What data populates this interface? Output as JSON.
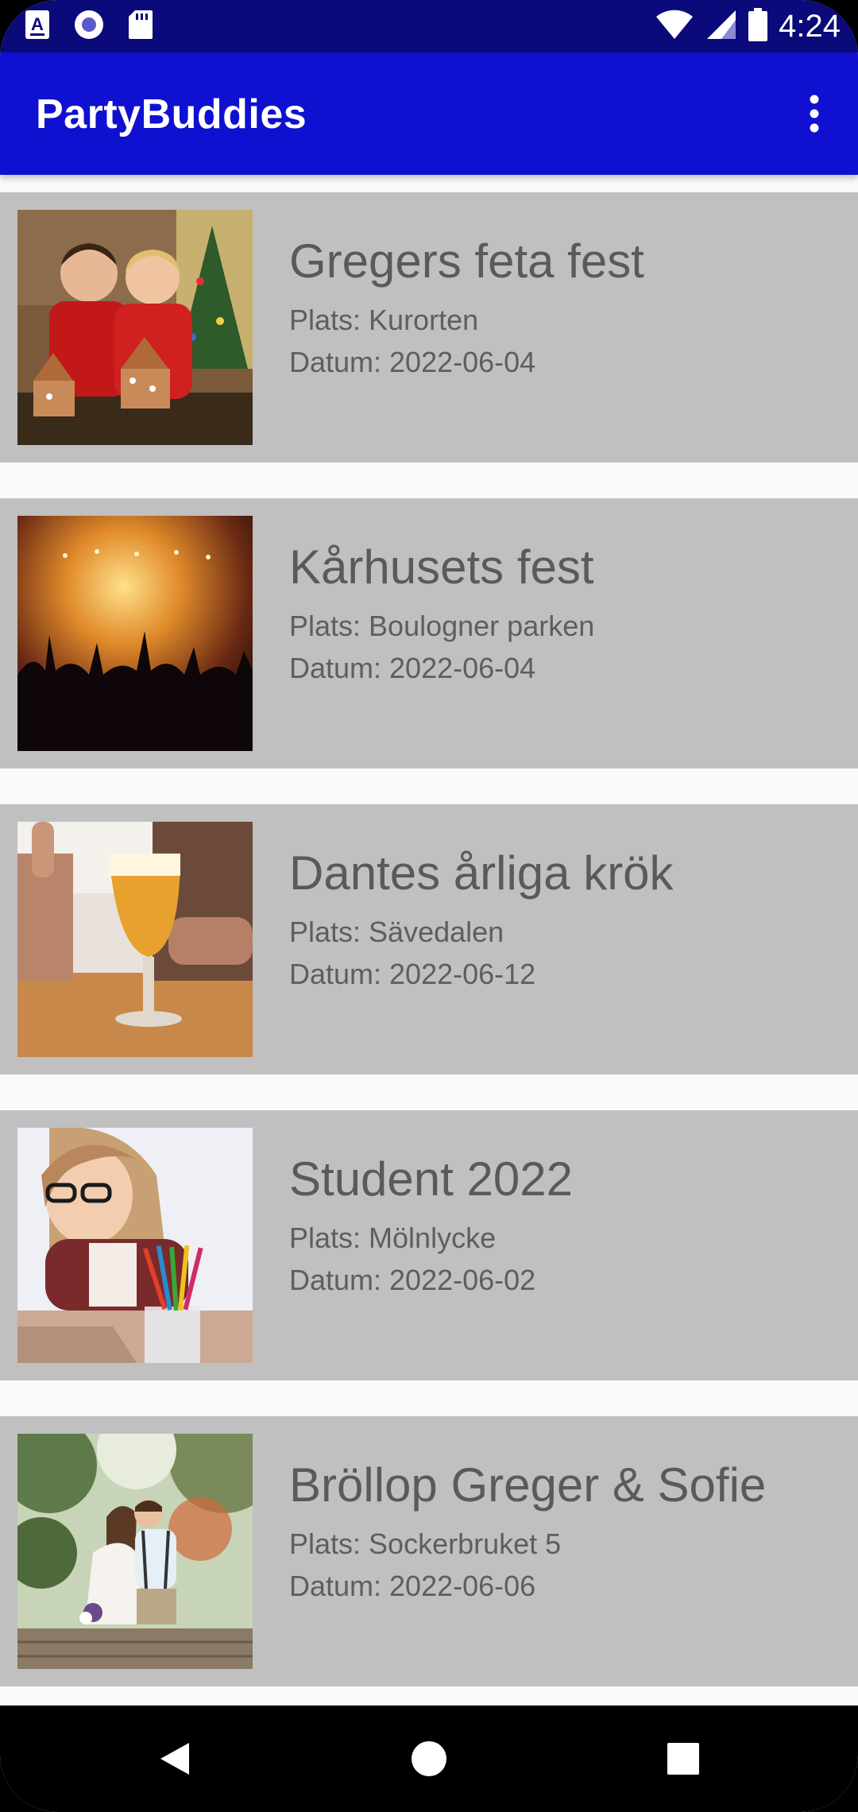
{
  "status_bar": {
    "time": "4:24",
    "icons": [
      "accessibility-a-icon",
      "record-circle-icon",
      "sd-card-icon",
      "wifi-icon",
      "cell-signal-icon",
      "battery-icon"
    ]
  },
  "app_bar": {
    "title": "PartyBuddies",
    "menu_icon": "more-vert-icon",
    "background_color": "#1010d0"
  },
  "parties": [
    {
      "title": "Gregers feta fest",
      "place": "Plats: Kurorten",
      "date": "Datum: 2022-06-04",
      "image": "two-boys-gingerbread-houses-photo"
    },
    {
      "title": "Kårhusets fest",
      "place": "Plats: Boulogner parken",
      "date": "Datum: 2022-06-04",
      "image": "concert-crowd-photo"
    },
    {
      "title": "Dantes årliga krök",
      "place": "Plats: Sävedalen",
      "date": "Datum: 2022-06-12",
      "image": "beer-glass-thumbs-up-photo"
    },
    {
      "title": "Student 2022",
      "place": "Plats: Mölnlycke",
      "date": "Datum: 2022-06-02",
      "image": "student-with-pencils-photo"
    },
    {
      "title": "Bröllop Greger & Sofie",
      "place": "Plats: Sockerbruket 5",
      "date": "Datum: 2022-06-06",
      "image": "wedding-couple-photo"
    }
  ],
  "nav_bar": {
    "buttons": [
      "back-icon",
      "home-icon",
      "recents-icon"
    ]
  }
}
